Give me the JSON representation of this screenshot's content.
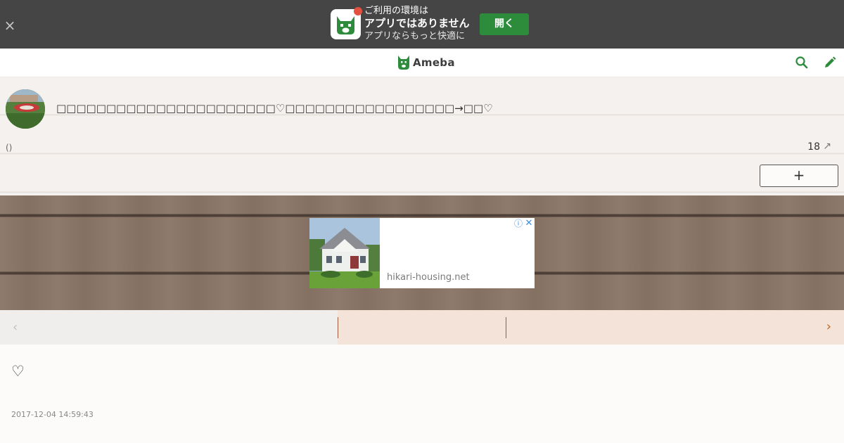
{
  "app_banner": {
    "line1": "ご利用の環境は",
    "line2": "アプリではありません",
    "line3": "アプリならもっと快適に",
    "open_label": "開く",
    "close_glyph": "×"
  },
  "header": {
    "logo_text": "Ameba",
    "search_icon": "search-icon",
    "edit_icon": "pencil-icon"
  },
  "profile": {
    "blog_title": "□□□□□□□□□□□□□□□□□□□□□□♡□□□□□□□□□□□□□□□□□→□□♡",
    "description": "()",
    "follower_count": "18",
    "follower_arrow": "↗",
    "follow_label": "+"
  },
  "ad": {
    "domain": "hikari-housing.net",
    "info_glyph": "ⓘ",
    "close_glyph": "✕"
  },
  "pager": {
    "prev_arrow": "‹",
    "next_arrow": "›"
  },
  "entry": {
    "body_text": "♡",
    "date": "2017-12-04 14:59:43"
  },
  "colors": {
    "banner_bg": "#454545",
    "open_button": "#2d8c3c",
    "brand_green": "#2d8c3c",
    "pager_accent": "#c2611c"
  }
}
